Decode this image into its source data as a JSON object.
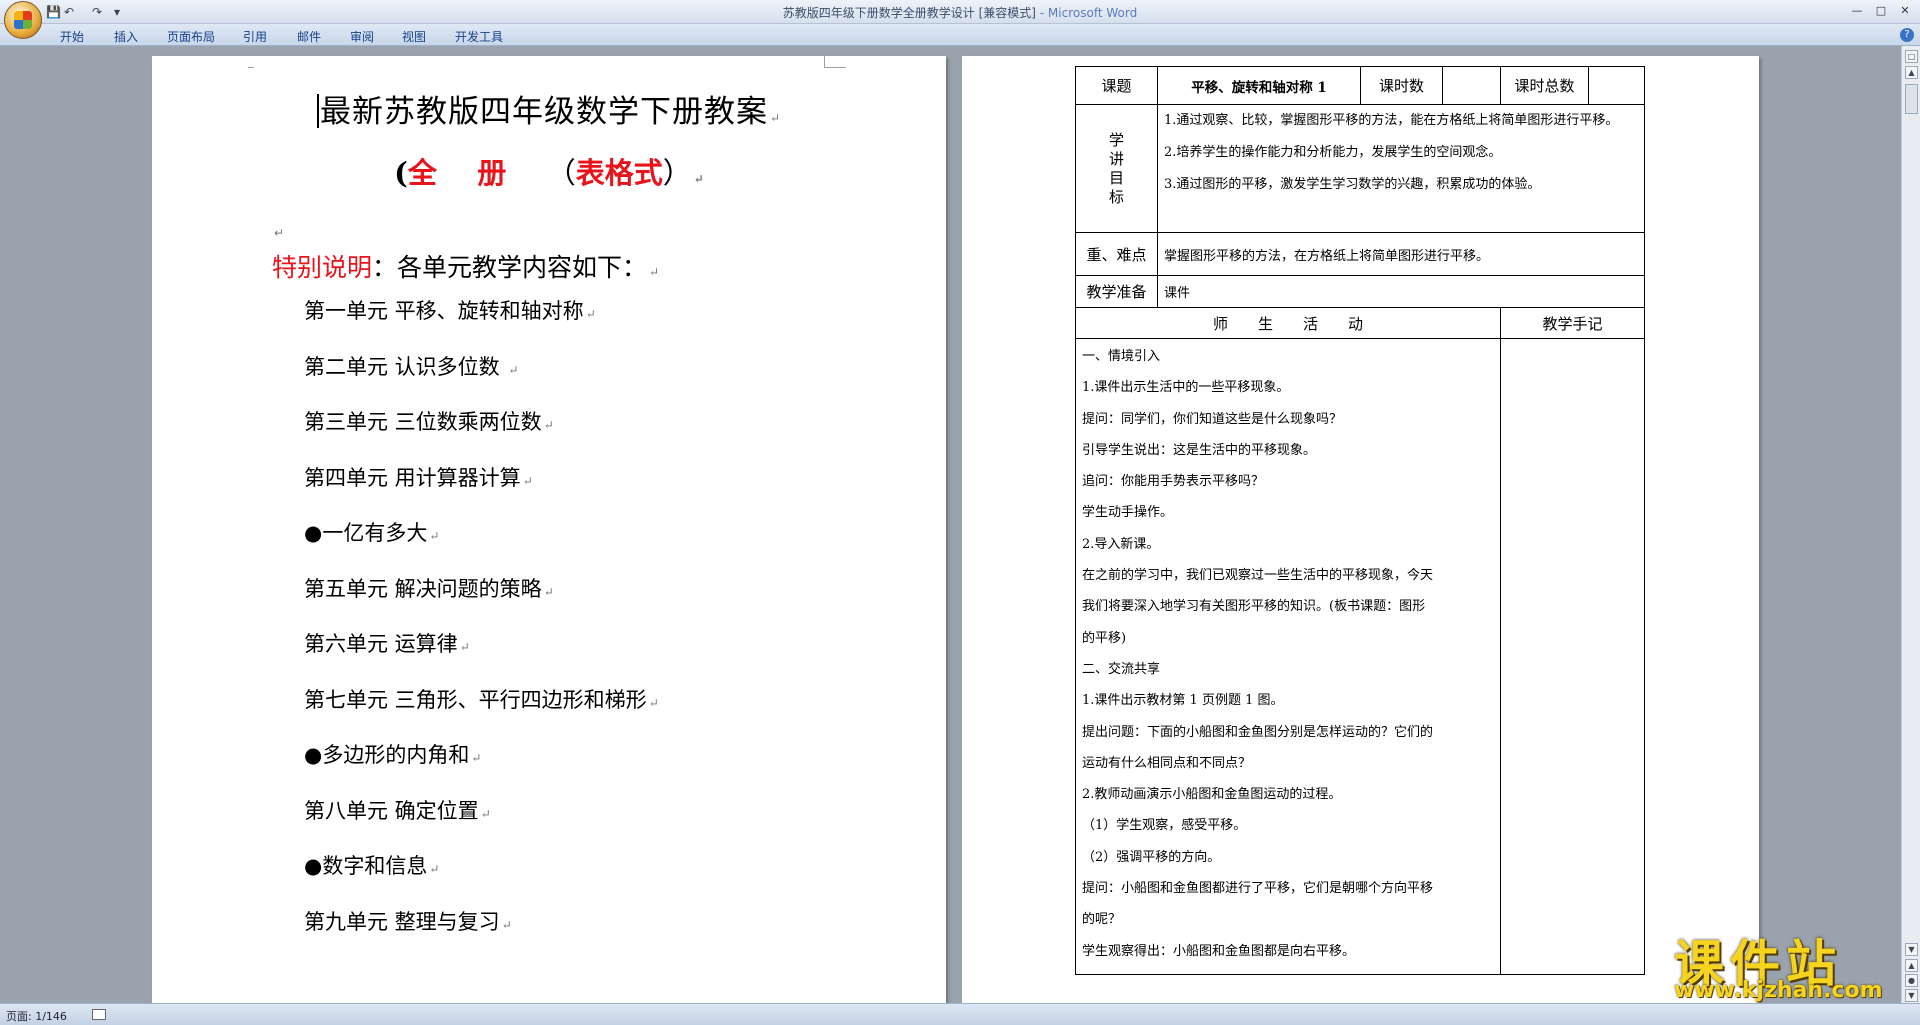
{
  "window": {
    "title": "苏教版四年级下册数学全册教学设计 [兼容模式]",
    "app": " - Microsoft Word"
  },
  "ribbon": {
    "tabs": [
      "开始",
      "插入",
      "页面布局",
      "引用",
      "邮件",
      "审阅",
      "视图",
      "开发工具"
    ]
  },
  "status": {
    "page": "页面: 1/146"
  },
  "left_page": {
    "title": "最新苏教版四年级数学下册教案",
    "subtitle": {
      "open": "(",
      "full": "全",
      "book": "册",
      ") ": ")",
      "format_open": "（",
      "format": "表格式",
      "format_close": "）"
    },
    "note": {
      "label": "特别说明",
      "text": "：各单元教学内容如下："
    },
    "units": [
      "第一单元 平移、旋转和轴对称",
      "第二单元 认识多位数 ",
      "第三单元 三位数乘两位数",
      "第四单元 用计算器计算",
      "●一亿有多大",
      "第五单元 解决问题的策略",
      "第六单元 运算律",
      "第七单元 三角形、平行四边形和梯形",
      "●多边形的内角和",
      "第八单元 确定位置",
      "●数字和信息",
      "第九单元 整理与复习"
    ]
  },
  "right_page": {
    "topic_label": "课题",
    "topic": "平移、旋转和轴对称 1",
    "hours_label": "课时数",
    "total_label": "课时总数",
    "objectives_label": [
      "学",
      "讲",
      "目",
      "标"
    ],
    "objectives": [
      "1.通过观察、比较，掌握图形平移的方法，能在方格纸上将简单图形进行平移。",
      "2.培养学生的操作能力和分析能力，发展学生的空间观念。",
      "3.通过图形的平移，激发学生学习数学的兴趣，积累成功的体验。"
    ],
    "key_label": "重、难点",
    "key": "掌握图形平移的方法，在方格纸上将简单图形进行平移。",
    "prep_label": "教学准备",
    "prep": "课件",
    "activity_header": "师　　生　　活　　动",
    "notes_header": "教学手记",
    "activities": [
      "一、情境引入",
      "1.课件出示生活中的一些平移现象。",
      "提问：同学们，你们知道这些是什么现象吗？",
      "引导学生说出：这是生活中的平移现象。",
      "追问：你能用手势表示平移吗？",
      "学生动手操作。",
      "2.导入新课。",
      "在之前的学习中，我们已观察过一些生活中的平移现象，今天",
      "我们将要深入地学习有关图形平移的知识。(板书课题：图形",
      "的平移)",
      "二、交流共享",
      "1.课件出示教材第 1 页例题 1 图。",
      "提出问题：下面的小船图和金鱼图分别是怎样运动的？它们的",
      "运动有什么相同点和不同点？",
      "2.教师动画演示小船图和金鱼图运动的过程。",
      "（1）学生观察，感受平移。",
      "（2）强调平移的方向。",
      "提问：小船图和金鱼图都进行了平移，它们是朝哪个方向平移",
      "的呢？",
      "学生观察得出：小船图和金鱼图都是向右平移。"
    ]
  },
  "watermark": {
    "main": "课件站",
    "url": "www.kjzhan.com"
  }
}
